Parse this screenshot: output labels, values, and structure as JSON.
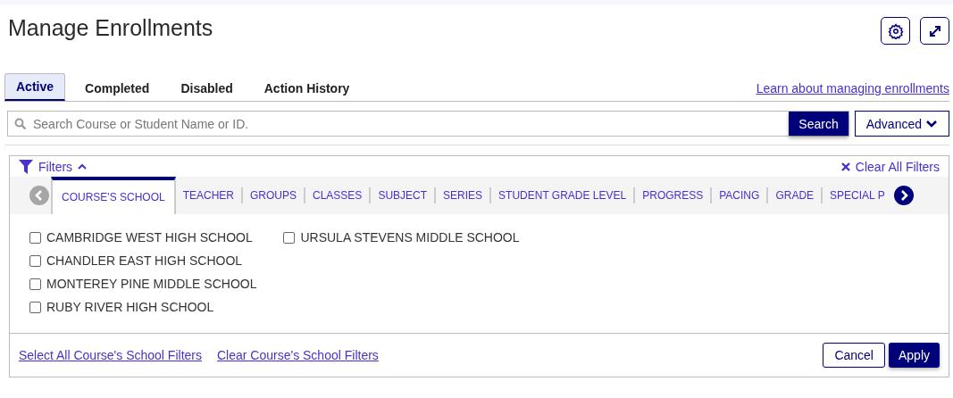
{
  "page": {
    "title": "Manage Enrollments"
  },
  "tabs": [
    {
      "label": "Active",
      "selected": true
    },
    {
      "label": "Completed",
      "selected": false
    },
    {
      "label": "Disabled",
      "selected": false
    },
    {
      "label": "Action History",
      "selected": false
    }
  ],
  "help_link": "Learn about managing enrollments",
  "search": {
    "placeholder": "Search Course or Student Name or ID.",
    "button": "Search",
    "advanced": "Advanced"
  },
  "filters": {
    "label": "Filters",
    "expanded": true,
    "clear_all": "Clear All Filters",
    "tabs": [
      {
        "label": "COURSE'S SCHOOL",
        "selected": true
      },
      {
        "label": "TEACHER",
        "selected": false
      },
      {
        "label": "GROUPS",
        "selected": false
      },
      {
        "label": "CLASSES",
        "selected": false
      },
      {
        "label": "SUBJECT",
        "selected": false
      },
      {
        "label": "SERIES",
        "selected": false
      },
      {
        "label": "STUDENT GRADE LEVEL",
        "selected": false
      },
      {
        "label": "PROGRESS",
        "selected": false
      },
      {
        "label": "PACING",
        "selected": false
      },
      {
        "label": "GRADE",
        "selected": false
      },
      {
        "label": "SPECIAL P",
        "selected": false
      }
    ],
    "options": [
      {
        "label": "CAMBRIDGE WEST HIGH SCHOOL",
        "checked": false
      },
      {
        "label": "CHANDLER EAST HIGH SCHOOL",
        "checked": false
      },
      {
        "label": "MONTEREY PINE MIDDLE SCHOOL",
        "checked": false
      },
      {
        "label": "RUBY RIVER HIGH SCHOOL",
        "checked": false
      },
      {
        "label": "URSULA STEVENS MIDDLE SCHOOL",
        "checked": false
      }
    ],
    "select_all": "Select All Course's School Filters",
    "clear": "Clear Course's School Filters",
    "cancel": "Cancel",
    "apply": "Apply"
  }
}
